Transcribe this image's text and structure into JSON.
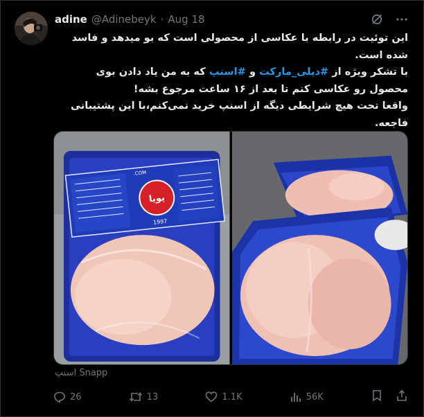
{
  "user": {
    "display_name": "adine",
    "handle": "@Adinebeyk",
    "separator": "·",
    "date": "Aug 18"
  },
  "tweet": {
    "line1": "این توئیت در رابطه با عکاسی از محصولی است که بو میدهد و فاسد شده است.",
    "line2_pre": "با تشکر ویژه از ",
    "hashtag1": "#دیلی_مارکت",
    "line2_mid": " و ",
    "hashtag2": "#اسنپ",
    "line2_post": " که به من یاد دادن بوی محصول رو عکاسی کنم تا بعد از ۱۶ ساعت مرجوع بشه!",
    "line3": "واقعا تحت هیچ شرایطی دیگه از اسنپ خرید نمی‌کنم،با این پشتیبانی فاجعه."
  },
  "media": {
    "source_label": "اسنپ Snapp",
    "package": {
      "brand": "پویا",
      "year": "1997",
      "web": ".COM",
      "weight": "۹۰۰ گرم",
      "product": "سینه مرغ بی پوست"
    }
  },
  "actions": {
    "replies": "26",
    "reposts": "13",
    "likes": "1.1K",
    "views": "56K"
  },
  "icons": [
    "grok-icon",
    "more-icon",
    "reply-icon",
    "repost-icon",
    "like-icon",
    "views-icon",
    "bookmark-icon",
    "share-icon"
  ],
  "colors": {
    "accent": "#1d9bf0",
    "muted": "#71767b",
    "text": "#e7e9ea",
    "background": "#000000"
  }
}
